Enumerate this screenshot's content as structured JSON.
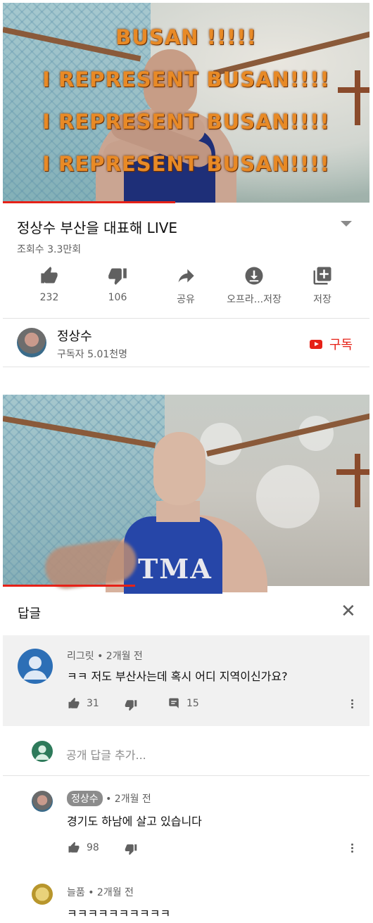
{
  "video1": {
    "overlay_lines": [
      "BUSAN !!!!!",
      "I REPRESENT BUSAN!!!!",
      "I REPRESENT BUSAN!!!!",
      "I REPRESENT BUSAN!!!!"
    ],
    "progress": 0.47
  },
  "info": {
    "title": "정상수 부산을 대표해 LIVE",
    "views": "조회수 3.3만회",
    "actions": [
      {
        "icon": "thumbs-up-icon",
        "label": "232"
      },
      {
        "icon": "thumbs-down-icon",
        "label": "106"
      },
      {
        "icon": "share-icon",
        "label": "공유"
      },
      {
        "icon": "download-icon",
        "label": "오프라...저장"
      },
      {
        "icon": "add-to-playlist-icon",
        "label": "저장"
      }
    ]
  },
  "channel": {
    "name": "정상수",
    "subscribers": "구독자 5.01천명",
    "subscribe_label": "구독",
    "accent": "#e62117"
  },
  "video2": {
    "shirt_text": "TMA",
    "progress": 0.36
  },
  "replies_panel": {
    "header": "답글",
    "parent": {
      "author_meta": "리그릿 • 2개월 전",
      "text": "ㅋㅋ 저도 부산사는데 혹시 어디 지역이신가요?",
      "likes": "31",
      "reply_count": "15"
    },
    "add_reply_placeholder": "공개 답글 추가...",
    "replies": [
      {
        "author": "정상수",
        "time": "• 2개월 전",
        "text": "경기도 하남에 살고 있습니다",
        "likes": "98"
      },
      {
        "author_meta": "늘품 • 2개월 전",
        "text": "ㅋㅋㅋㅋㅋㅋㅋㅋㅋㅋ"
      }
    ]
  }
}
